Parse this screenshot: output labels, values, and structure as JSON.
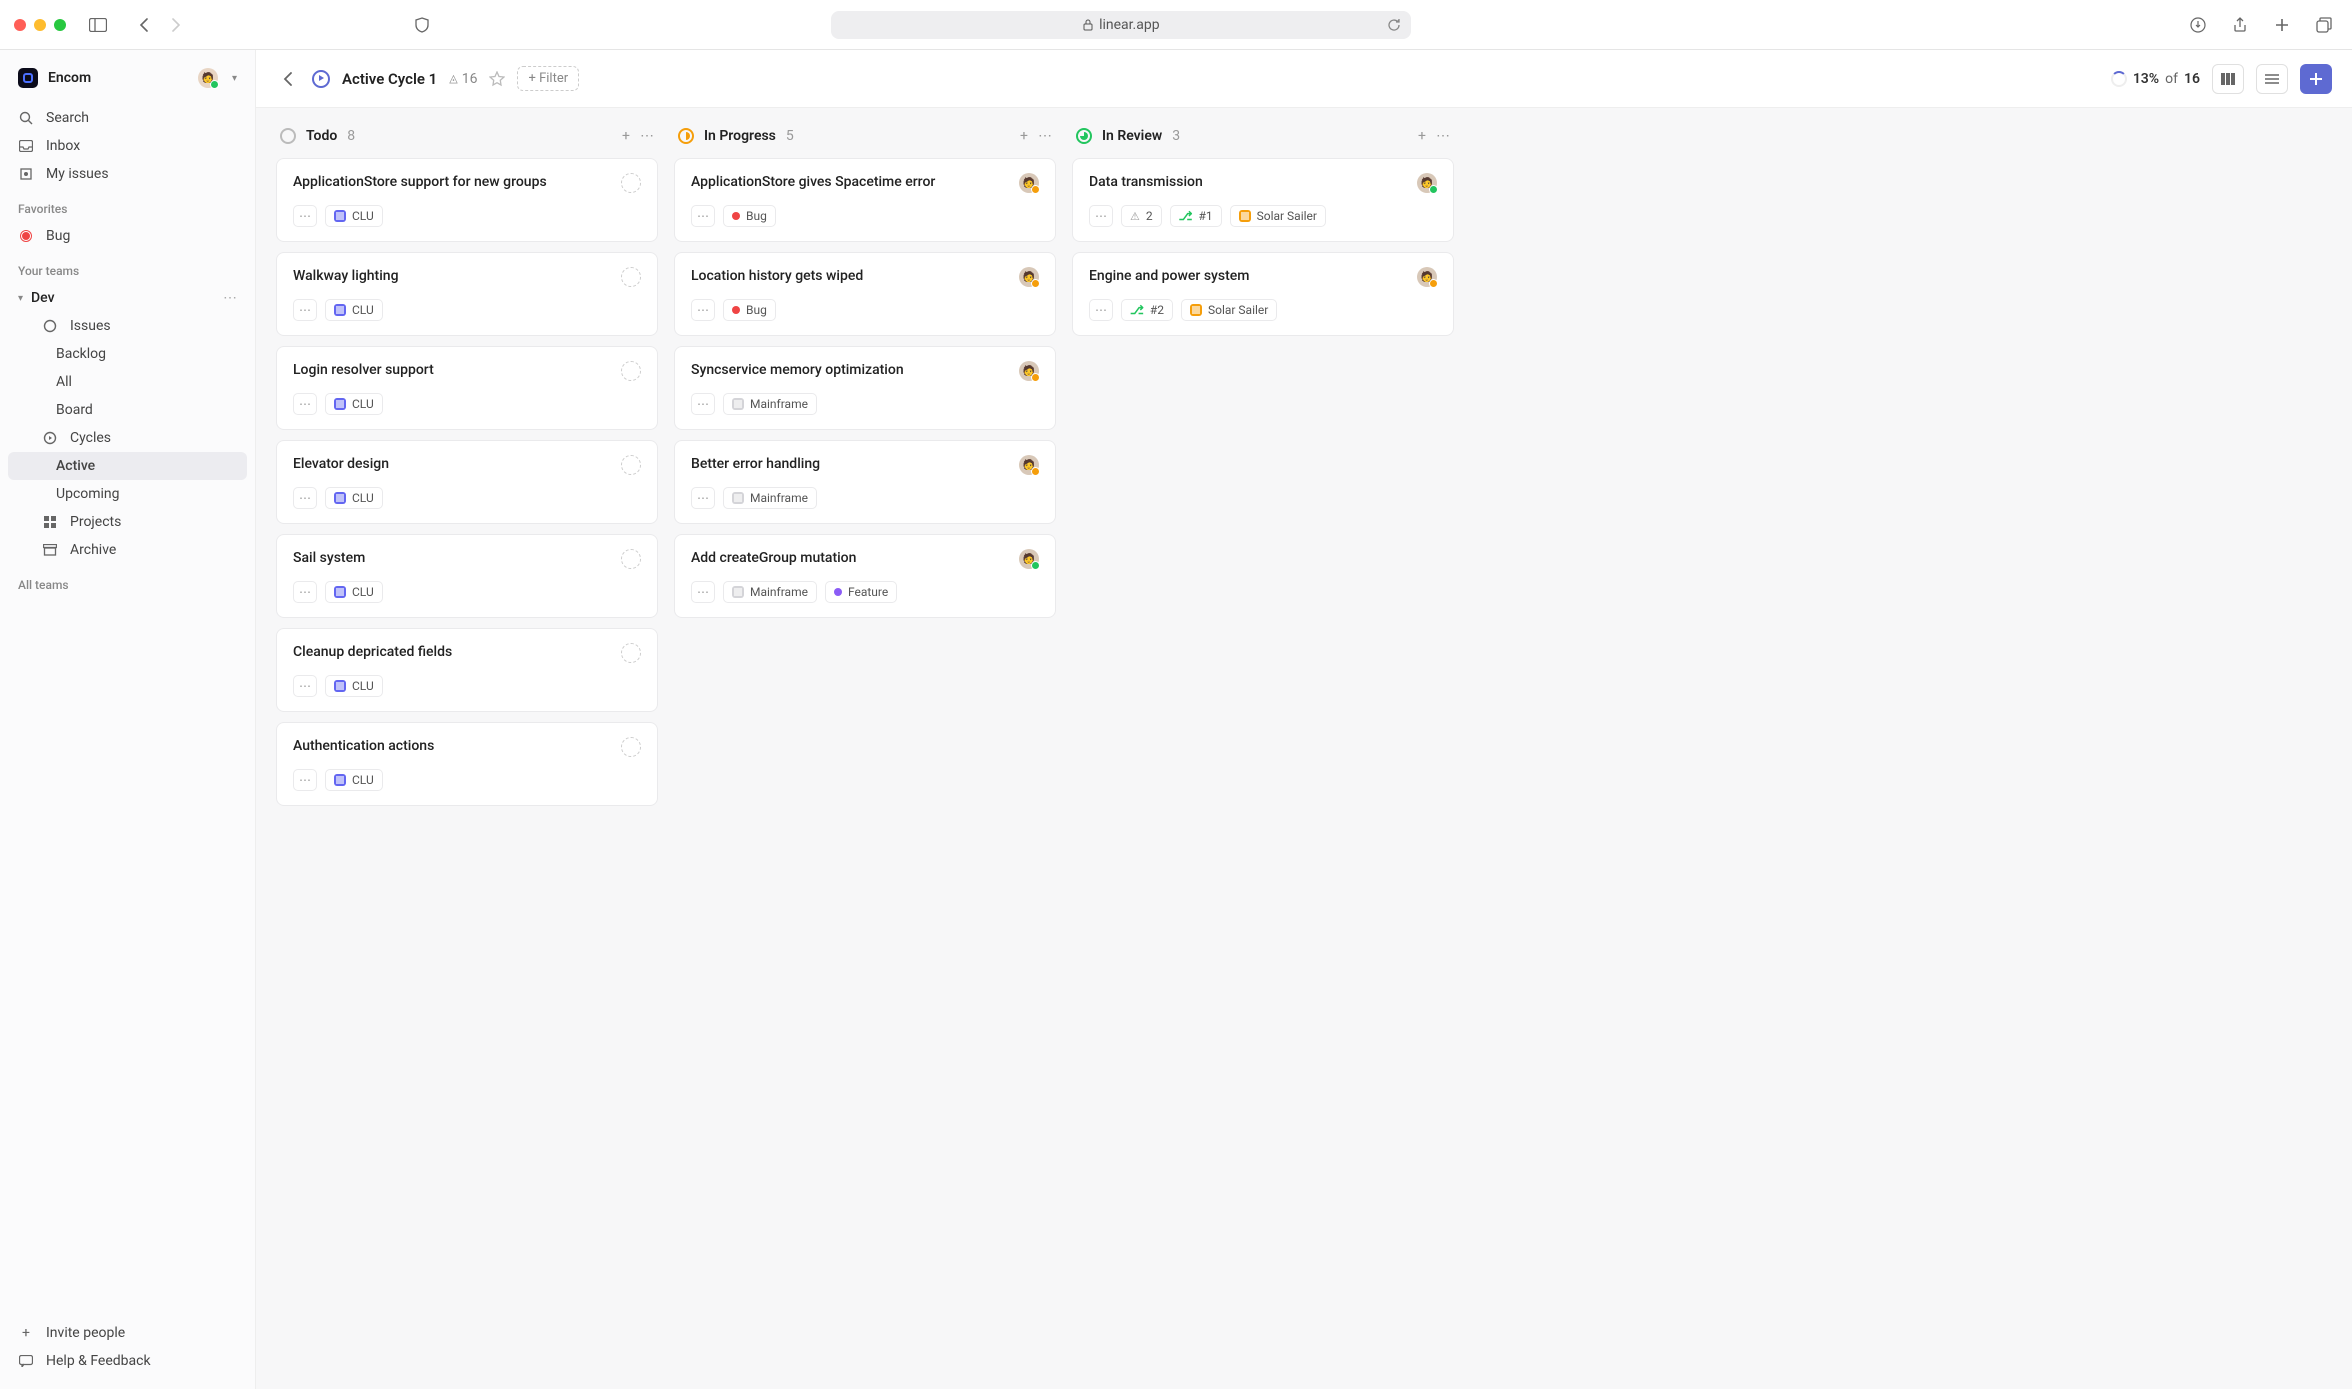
{
  "browser": {
    "url": "linear.app"
  },
  "workspace": {
    "name": "Encom"
  },
  "sidebar": {
    "search": "Search",
    "inbox": "Inbox",
    "my_issues": "My issues",
    "favorites_label": "Favorites",
    "favorites": [
      {
        "label": "Bug"
      }
    ],
    "your_teams_label": "Your teams",
    "team": "Dev",
    "team_items": {
      "issues": "Issues",
      "backlog": "Backlog",
      "all": "All",
      "board": "Board",
      "cycles": "Cycles",
      "active": "Active",
      "upcoming": "Upcoming",
      "projects": "Projects",
      "archive": "Archive"
    },
    "all_teams": "All teams",
    "invite": "Invite people",
    "help": "Help & Feedback"
  },
  "header": {
    "title": "Active Cycle 1",
    "scope_count": "16",
    "filter_label": "+ Filter",
    "progress_pct": "13%",
    "of_label": "of",
    "total": "16"
  },
  "columns": [
    {
      "status": "todo",
      "title": "Todo",
      "count": "8",
      "cards": [
        {
          "title": "ApplicationStore support for new groups",
          "assignee": null,
          "chips": [
            {
              "kind": "project",
              "icon": "purple",
              "label": "CLU"
            }
          ]
        },
        {
          "title": "Walkway lighting",
          "assignee": null,
          "chips": [
            {
              "kind": "project",
              "icon": "purple",
              "label": "CLU"
            }
          ]
        },
        {
          "title": "Login resolver support",
          "assignee": null,
          "chips": [
            {
              "kind": "project",
              "icon": "purple",
              "label": "CLU"
            }
          ]
        },
        {
          "title": "Elevator design",
          "assignee": null,
          "chips": [
            {
              "kind": "project",
              "icon": "purple",
              "label": "CLU"
            }
          ]
        },
        {
          "title": "Sail system",
          "assignee": null,
          "chips": [
            {
              "kind": "project",
              "icon": "purple",
              "label": "CLU"
            }
          ]
        },
        {
          "title": "Cleanup depricated fields",
          "assignee": null,
          "chips": [
            {
              "kind": "project",
              "icon": "purple",
              "label": "CLU"
            }
          ]
        },
        {
          "title": "Authentication actions",
          "assignee": null,
          "chips": [
            {
              "kind": "project",
              "icon": "purple",
              "label": "CLU"
            }
          ]
        }
      ]
    },
    {
      "status": "progress",
      "title": "In Progress",
      "count": "5",
      "cards": [
        {
          "title": "ApplicationStore gives Spacetime error",
          "assignee": "away",
          "chips": [
            {
              "kind": "label",
              "dot": "red",
              "label": "Bug"
            }
          ]
        },
        {
          "title": "Location history gets wiped",
          "assignee": "away",
          "chips": [
            {
              "kind": "label",
              "dot": "red",
              "label": "Bug"
            }
          ]
        },
        {
          "title": "Syncservice memory optimization",
          "assignee": "away",
          "chips": [
            {
              "kind": "project",
              "icon": "gray",
              "label": "Mainframe"
            }
          ]
        },
        {
          "title": "Better error handling",
          "assignee": "away",
          "chips": [
            {
              "kind": "project",
              "icon": "gray",
              "label": "Mainframe"
            }
          ]
        },
        {
          "title": "Add createGroup mutation",
          "assignee": "online",
          "chips": [
            {
              "kind": "project",
              "icon": "gray",
              "label": "Mainframe"
            },
            {
              "kind": "label",
              "dot": "purple",
              "label": "Feature"
            }
          ]
        }
      ]
    },
    {
      "status": "review",
      "title": "In Review",
      "count": "3",
      "cards": [
        {
          "title": "Data transmission",
          "assignee": "online",
          "chips": [
            {
              "kind": "blocked",
              "label": "2"
            },
            {
              "kind": "pr",
              "label": "#1"
            },
            {
              "kind": "project",
              "icon": "orange",
              "label": "Solar Sailer"
            }
          ]
        },
        {
          "title": "Engine and power system",
          "assignee": "away",
          "chips": [
            {
              "kind": "pr",
              "label": "#2"
            },
            {
              "kind": "project",
              "icon": "orange",
              "label": "Solar Sailer"
            }
          ]
        }
      ]
    }
  ]
}
